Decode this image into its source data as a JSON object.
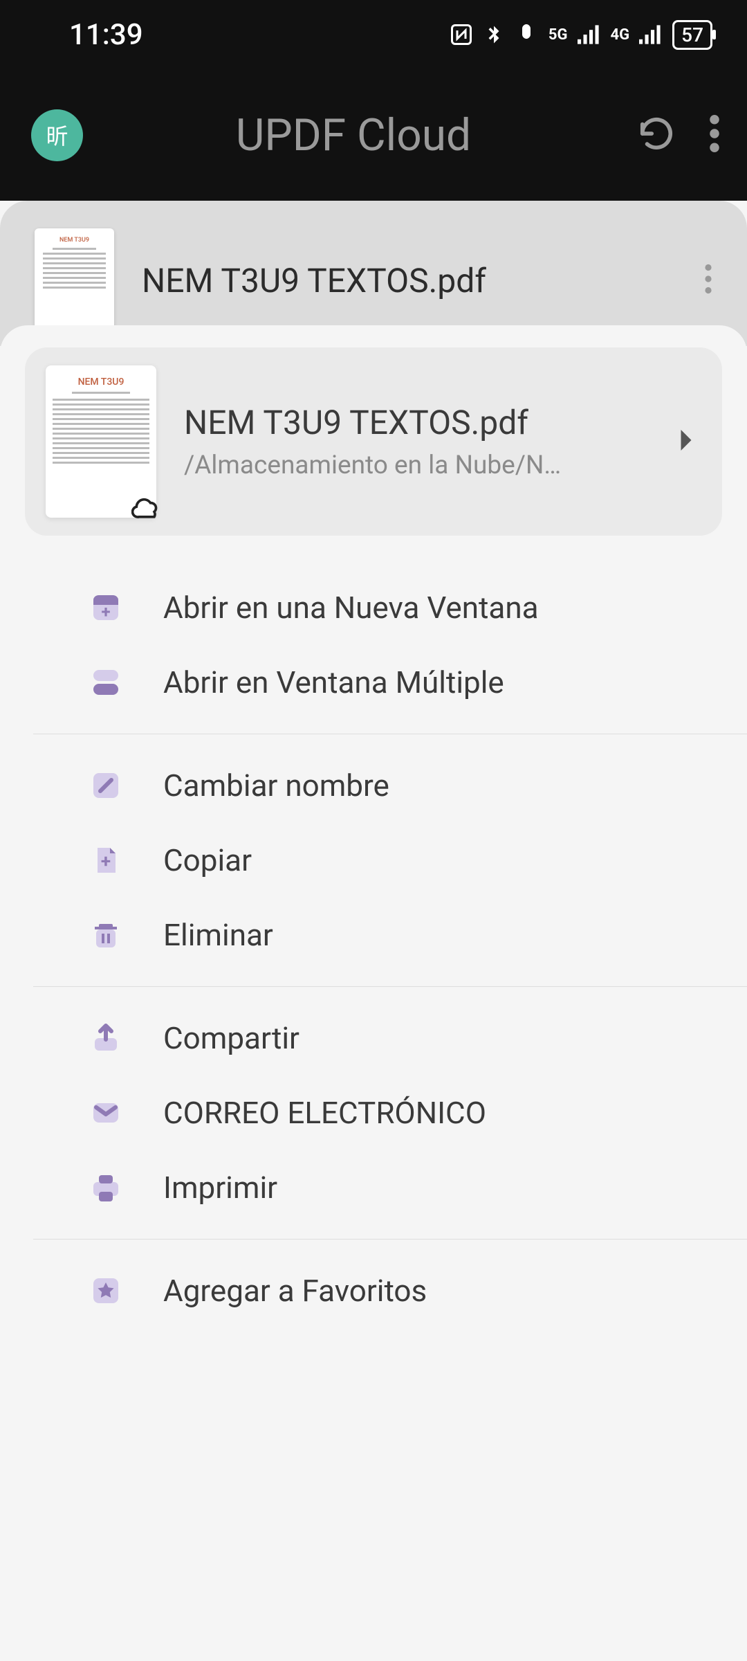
{
  "status": {
    "time": "11:39",
    "battery": "57"
  },
  "header": {
    "avatar_text": "昕",
    "title": "UPDF Cloud"
  },
  "file_row": {
    "name": "NEM T3U9 TEXTOS.pdf"
  },
  "sheet": {
    "file_name": "NEM T3U9 TEXTOS.pdf",
    "file_path": "/Almacenamiento en la Nube/N…",
    "thumb_title": "NEM T3U9"
  },
  "menu": {
    "open_new_window": "Abrir en una Nueva Ventana",
    "open_multi_window": "Abrir en Ventana Múltiple",
    "rename": "Cambiar nombre",
    "copy": "Copiar",
    "delete": "Eliminar",
    "share": "Compartir",
    "email": "CORREO ELECTRÓNICO",
    "print": "Imprimir",
    "favorite": "Agregar a Favoritos"
  },
  "colors": {
    "accent": "#8f7ab5",
    "icon_bg": "#d5ccea"
  }
}
